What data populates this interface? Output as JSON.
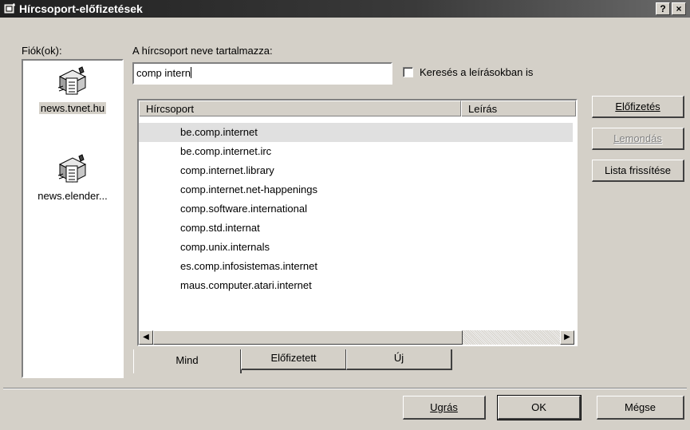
{
  "window": {
    "title": "Hírcsoport-előfizetések",
    "help_btn": "?",
    "close_btn": "×"
  },
  "accounts": {
    "label": "Fiók(ok):",
    "items": [
      {
        "name": "news.tvnet.hu",
        "selected": true
      },
      {
        "name": "news.elender...",
        "selected": false
      }
    ]
  },
  "search": {
    "label": "A hírcsoport neve tartalmazza:",
    "value": "comp intern",
    "desc_checkbox_label": "Keresés a leírásokban is",
    "desc_checked": false
  },
  "list": {
    "columns": [
      "Hírcsoport",
      "Leírás"
    ],
    "rows": [
      "be.comp.internet",
      "be.comp.internet.irc",
      "comp.internet.library",
      "comp.internet.net-happenings",
      "comp.software.international",
      "comp.std.internat",
      "comp.unix.internals",
      "es.comp.infosistemas.internet",
      "maus.computer.atari.internet"
    ],
    "selected_index": 0
  },
  "tabs": [
    "Mind",
    "Előfizetett",
    "Új"
  ],
  "side_buttons": {
    "subscribe": "Előfizetés",
    "unsubscribe": "Lemondás",
    "refresh": "Lista frissítése"
  },
  "bottom_buttons": {
    "goto": "Ugrás",
    "ok": "OK",
    "cancel": "Mégse"
  }
}
